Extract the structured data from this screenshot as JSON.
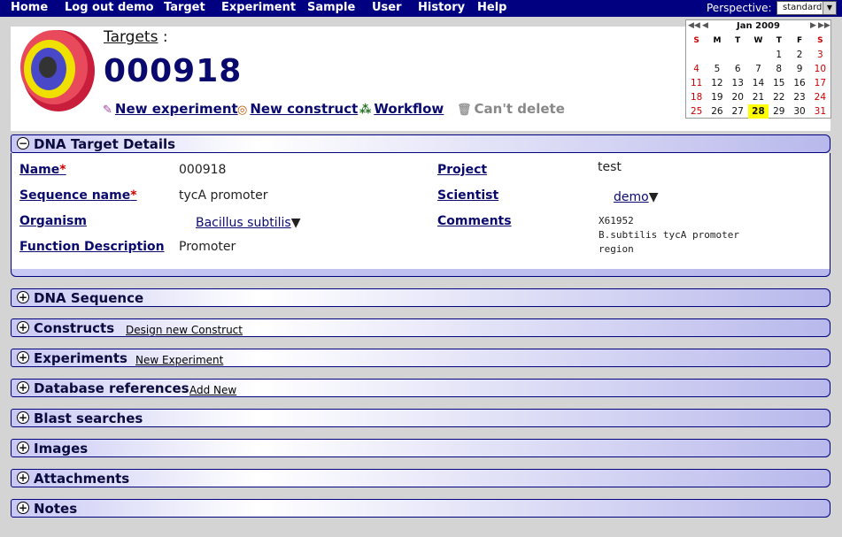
{
  "nav": {
    "items": [
      "Home",
      "Log out demo",
      "Target",
      "Experiment",
      "Sample",
      "User",
      "History",
      "Help"
    ],
    "perspective_label": "Perspective:",
    "perspective_value": "standard"
  },
  "header": {
    "breadcrumb": "Targets",
    "colon": ":",
    "target_id": "000918",
    "actions": {
      "new_experiment": "New experiment",
      "new_construct": "New construct",
      "workflow": "Workflow",
      "cant_delete": "Can't delete"
    }
  },
  "calendar": {
    "month": "Jan 2009",
    "dow": [
      "S",
      "M",
      "T",
      "W",
      "T",
      "F",
      "S"
    ],
    "weeks": [
      [
        "",
        "",
        "",
        "",
        "1",
        "2",
        "3"
      ],
      [
        "4",
        "5",
        "6",
        "7",
        "8",
        "9",
        "10"
      ],
      [
        "11",
        "12",
        "13",
        "14",
        "15",
        "16",
        "17"
      ],
      [
        "18",
        "19",
        "20",
        "21",
        "22",
        "23",
        "24"
      ],
      [
        "25",
        "26",
        "27",
        "28",
        "29",
        "30",
        "31"
      ]
    ],
    "today": "28"
  },
  "details": {
    "title": "DNA Target Details",
    "name_label": "Name",
    "name_value": "000918",
    "seq_label": "Sequence name",
    "seq_value": "tycA promoter",
    "organism_label": "Organism",
    "organism_value": "Bacillus subtilis",
    "function_label": "Function Description",
    "function_value": "Promoter",
    "project_label": "Project",
    "project_value": "test",
    "scientist_label": "Scientist",
    "scientist_value": "demo",
    "comments_label": "Comments",
    "comments_lines": [
      "X61952",
      "B.subtilis tycA promoter",
      "region"
    ],
    "required_mark": "*"
  },
  "sections": {
    "dna_sequence": "DNA Sequence",
    "constructs": "Constructs",
    "constructs_link": "Design new Construct",
    "experiments": "Experiments",
    "experiments_link": "New Experiment",
    "dbrefs": "Database references",
    "dbrefs_link": "Add New",
    "blast": "Blast searches",
    "images": "Images",
    "attachments": "Attachments",
    "notes": "Notes"
  },
  "colors": {
    "nav_bg": "#000080",
    "accent": "#0a0a6e",
    "required": "#cc0000"
  }
}
